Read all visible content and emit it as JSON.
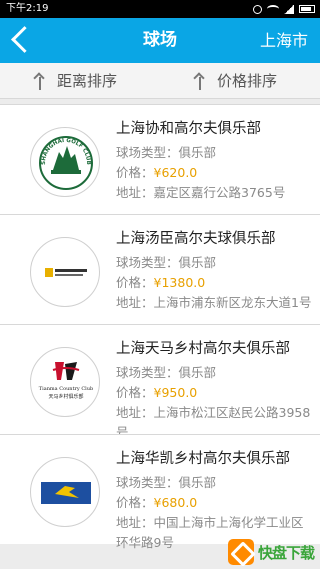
{
  "status_bar": {
    "time": "下午2:19"
  },
  "nav": {
    "title": "球场",
    "city": "上海市"
  },
  "sort": {
    "distance": "距离排序",
    "price": "价格排序"
  },
  "clubs": [
    {
      "name": "上海协和高尔夫俱乐部",
      "type_label": "球场类型：",
      "type": "俱乐部",
      "price_label": "价格：",
      "price": "¥620.0",
      "address_label": "地址：",
      "address": "嘉定区嘉行公路3765号"
    },
    {
      "name": "上海汤臣高尔夫球俱乐部",
      "type_label": "球场类型：",
      "type": "俱乐部",
      "price_label": "价格：",
      "price": "¥1380.0",
      "address_label": "地址：",
      "address": "上海市浦东新区龙东大道1号"
    },
    {
      "name": "上海天马乡村高尔夫俱乐部",
      "type_label": "球场类型：",
      "type": "俱乐部",
      "price_label": "价格：",
      "price": "¥950.0",
      "address_label": "地址：",
      "address": "上海市松江区赵民公路3958号"
    },
    {
      "name": "上海华凯乡村高尔夫俱乐部",
      "type_label": "球场类型：",
      "type": "俱乐部",
      "price_label": "价格：",
      "price": "¥680.0",
      "address_label": "地址：",
      "address": "中国上海市上海化学工业区环华路9号"
    }
  ],
  "logos": {
    "club1_text": "SHANGHAI GOLF CLUB",
    "club3_en": "Tianma Country Club",
    "club3_cn": "天马乡村俱乐部"
  },
  "watermark": {
    "text": "快盘下载"
  },
  "colors": {
    "nav": "#0aa6e5",
    "price": "#e8a000"
  }
}
